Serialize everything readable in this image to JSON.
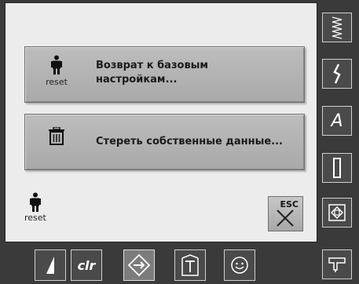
{
  "reset_settings": {
    "icon": "person-reset-icon",
    "caption": "reset",
    "label_line1": "Возврат к базовым",
    "label_line2": "настройкам..."
  },
  "delete_data": {
    "icon": "trash-icon",
    "label": "Стереть собственные данные..."
  },
  "status_reset": {
    "icon": "person-reset-icon",
    "caption": "reset"
  },
  "esc_button": {
    "label": "ESC",
    "icon": "close-x-icon"
  },
  "side_toolbar": [
    {
      "name": "stitch-pattern-icon"
    },
    {
      "name": "decorative-stitch-icon"
    },
    {
      "name": "alphabet-icon",
      "text": "A"
    },
    {
      "name": "buttonhole-icon"
    },
    {
      "name": "quilt-icon"
    },
    {
      "name": "sewing-machine-icon"
    }
  ],
  "bottom_toolbar": [
    {
      "name": "needle-stop-icon"
    },
    {
      "name": "clr-icon",
      "text": "clr"
    },
    {
      "name": "setup-icon",
      "active": true
    },
    {
      "name": "tutorial-icon"
    },
    {
      "name": "eco-icon"
    }
  ]
}
